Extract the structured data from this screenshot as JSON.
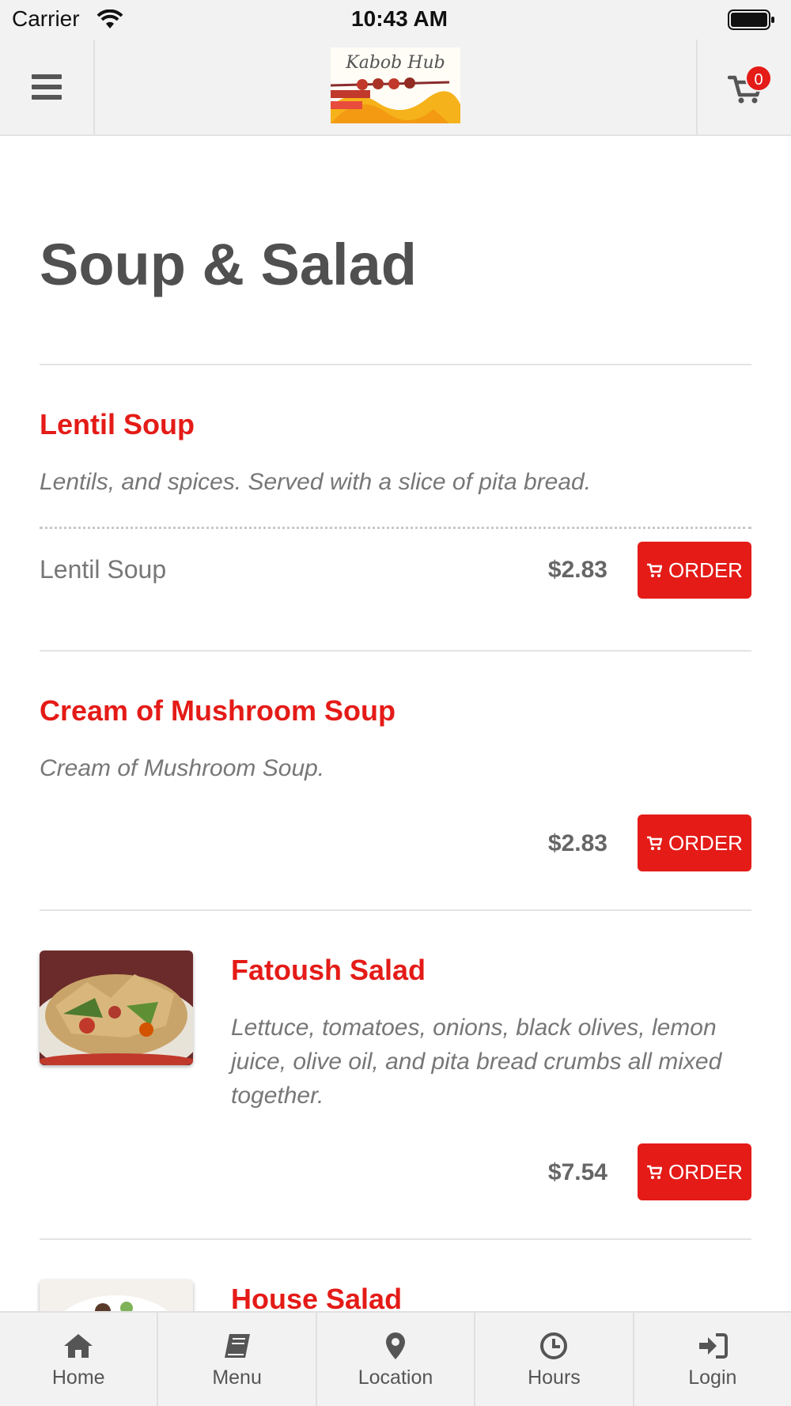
{
  "status_bar": {
    "carrier": "Carrier",
    "time": "10:43 AM"
  },
  "header": {
    "logo_text": "Kabob Hub",
    "cart_count": "0"
  },
  "page": {
    "title": "Soup & Salad"
  },
  "items": [
    {
      "title": "Lentil Soup",
      "description": "Lentils, and spices. Served with a slice of pita bread.",
      "size_label": "Lentil Soup",
      "price": "$2.83",
      "order_label": "ORDER"
    },
    {
      "title": "Cream of Mushroom Soup",
      "description": "Cream of Mushroom Soup.",
      "price": "$2.83",
      "order_label": "ORDER"
    },
    {
      "title": "Fatoush Salad",
      "description": "Lettuce, tomatoes, onions, black olives, lemon juice, olive oil, and pita bread crumbs all mixed together.",
      "price": "$7.54",
      "order_label": "ORDER"
    },
    {
      "title": "House Salad"
    }
  ],
  "tabbar": [
    {
      "label": "Home",
      "icon": "home-icon"
    },
    {
      "label": "Menu",
      "icon": "book-icon"
    },
    {
      "label": "Location",
      "icon": "map-pin-icon"
    },
    {
      "label": "Hours",
      "icon": "clock-icon"
    },
    {
      "label": "Login",
      "icon": "sign-in-icon"
    }
  ],
  "colors": {
    "accent": "#e41b17",
    "bar_bg": "#f2f2f2",
    "text": "#555555"
  }
}
